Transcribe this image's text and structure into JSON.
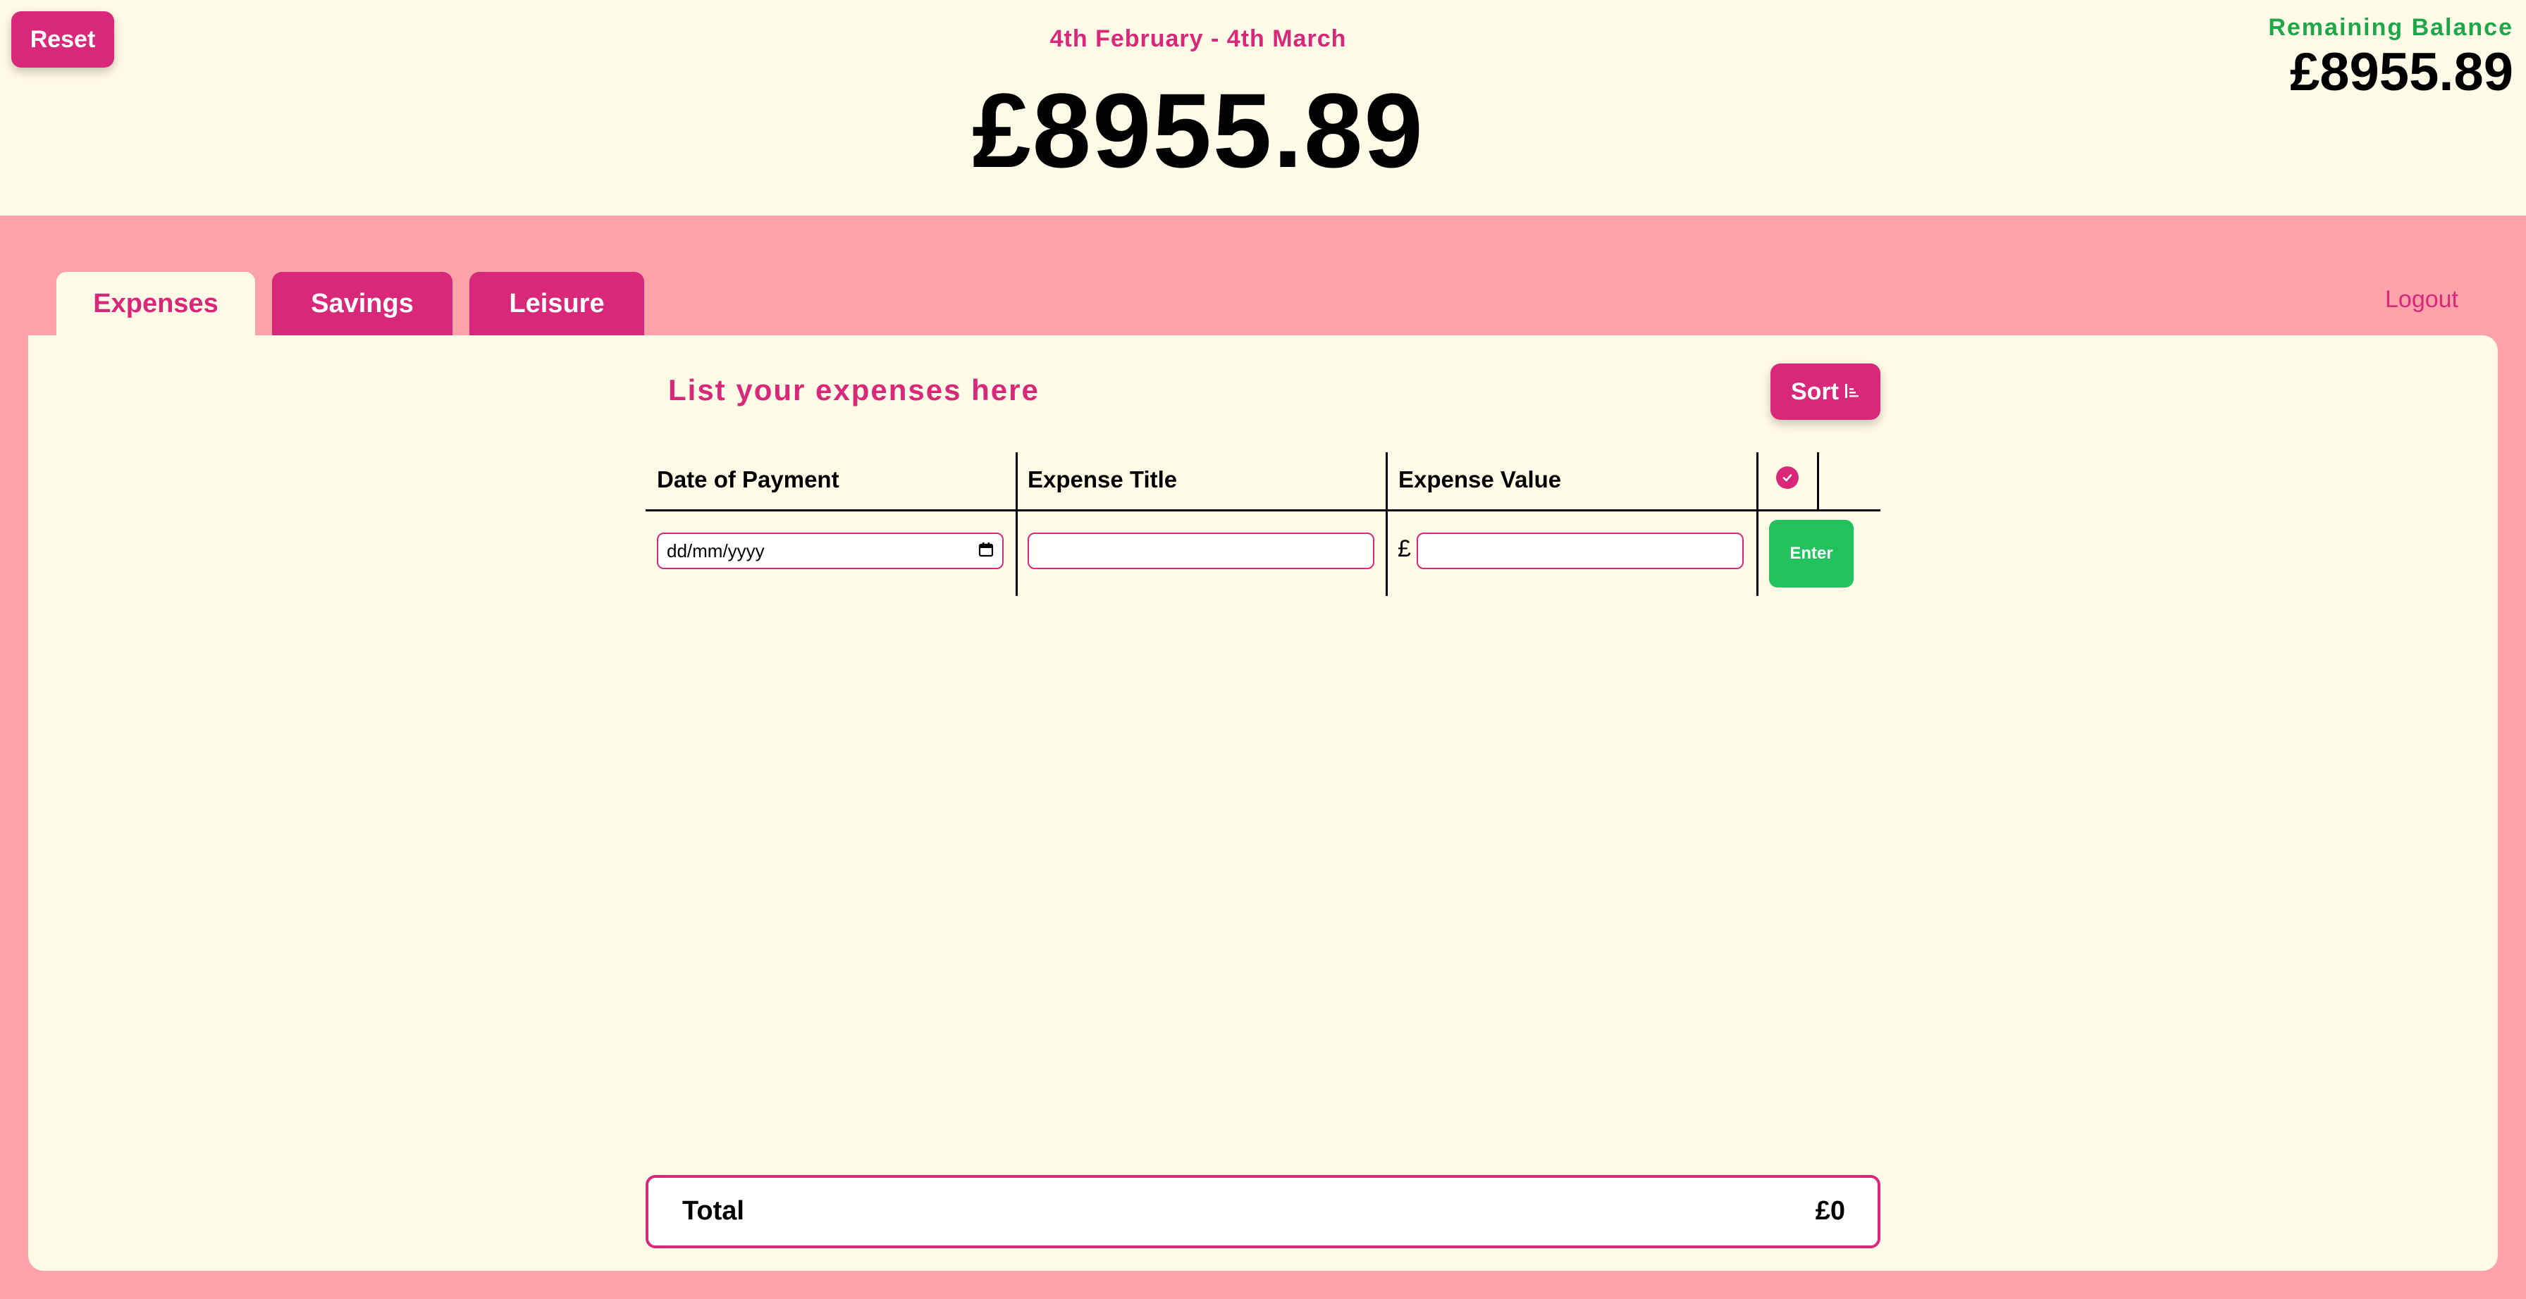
{
  "header": {
    "reset_label": "Reset",
    "period": "4th February - 4th March",
    "main_balance": "£8955.89",
    "remaining_label": "Remaining Balance",
    "remaining_value": "£8955.89"
  },
  "tabs": [
    {
      "label": "Expenses",
      "active": true
    },
    {
      "label": "Savings",
      "active": false
    },
    {
      "label": "Leisure",
      "active": false
    }
  ],
  "logout_label": "Logout",
  "panel": {
    "title": "List your expenses here",
    "sort_label": "Sort",
    "sort_icon": "sort-ascending-icon",
    "columns": [
      "Date of Payment",
      "Expense Title",
      "Expense Value"
    ],
    "check_icon": "check-circle-icon",
    "date_placeholder": "dd/mm/yyyy",
    "currency_symbol": "£",
    "enter_label": "Enter",
    "total_label": "Total",
    "total_value": "£0"
  },
  "colors": {
    "accent": "#d9287a",
    "background": "#fffbe6",
    "band": "#ffa3ab",
    "positive": "#1fa64a",
    "enter_button": "#22c35e"
  }
}
